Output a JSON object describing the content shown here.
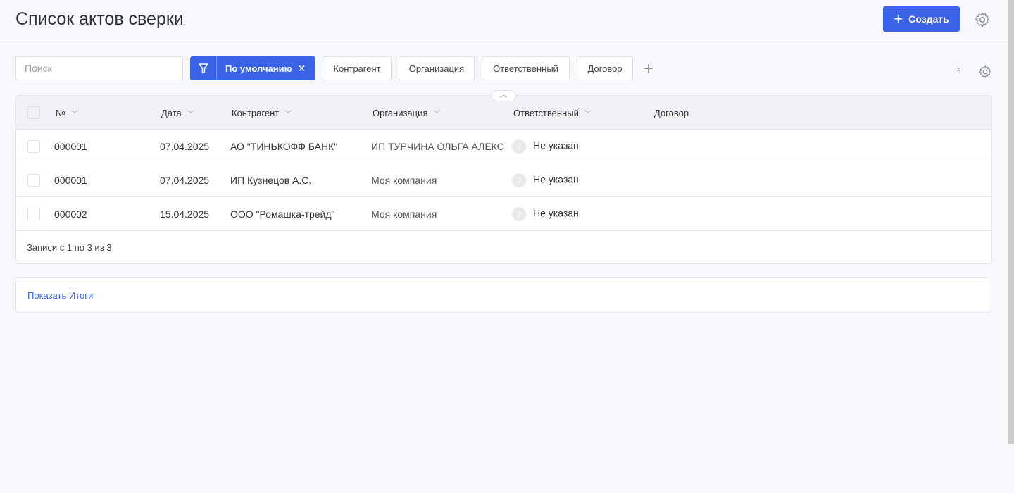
{
  "header": {
    "title": "Список актов сверки",
    "create_label": "Создать"
  },
  "filters": {
    "search_placeholder": "Поиск",
    "preset_label": "По умолчанию",
    "chips": [
      "Контрагент",
      "Организация",
      "Ответственный",
      "Договор"
    ]
  },
  "table": {
    "columns": [
      "№",
      "Дата",
      "Контрагент",
      "Организация",
      "Ответственный",
      "Договор"
    ],
    "rows": [
      {
        "number": "000001",
        "date": "07.04.2025",
        "counterparty": "АО \"ТИНЬКОФФ БАНК\"",
        "organization": "ИП ТУРЧИНА ОЛЬГА АЛЕКСЕ",
        "responsible": "Не указан"
      },
      {
        "number": "000001",
        "date": "07.04.2025",
        "counterparty": "ИП Кузнецов А.С.",
        "organization": "Моя компания",
        "responsible": "Не указан"
      },
      {
        "number": "000002",
        "date": "15.04.2025",
        "counterparty": "ООО \"Ромашка-трейд\"",
        "organization": "Моя компания",
        "responsible": "Не указан"
      }
    ],
    "footer": "Записи с 1 по 3 из 3"
  },
  "totals": {
    "link": "Показать Итоги"
  },
  "colors": {
    "accent": "#3a63e8"
  }
}
